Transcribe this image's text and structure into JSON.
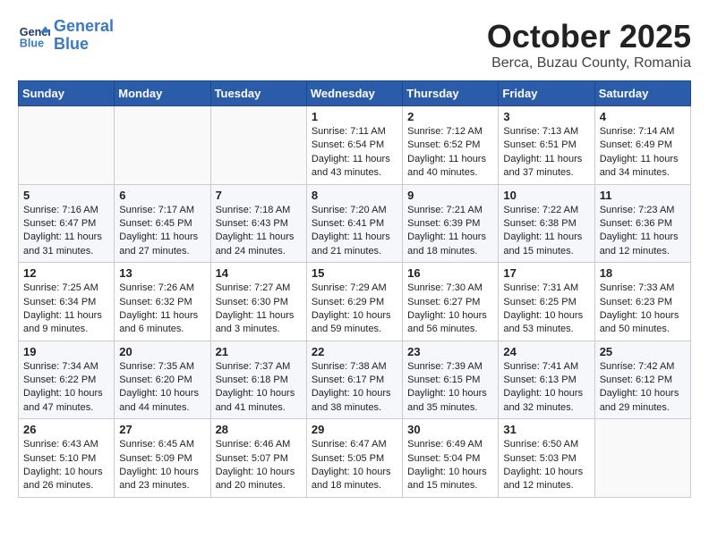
{
  "header": {
    "logo_line1": "General",
    "logo_line2": "Blue",
    "month": "October 2025",
    "location": "Berca, Buzau County, Romania"
  },
  "weekdays": [
    "Sunday",
    "Monday",
    "Tuesday",
    "Wednesday",
    "Thursday",
    "Friday",
    "Saturday"
  ],
  "weeks": [
    [
      {
        "day": "",
        "info": ""
      },
      {
        "day": "",
        "info": ""
      },
      {
        "day": "",
        "info": ""
      },
      {
        "day": "1",
        "info": "Sunrise: 7:11 AM\nSunset: 6:54 PM\nDaylight: 11 hours and 43 minutes."
      },
      {
        "day": "2",
        "info": "Sunrise: 7:12 AM\nSunset: 6:52 PM\nDaylight: 11 hours and 40 minutes."
      },
      {
        "day": "3",
        "info": "Sunrise: 7:13 AM\nSunset: 6:51 PM\nDaylight: 11 hours and 37 minutes."
      },
      {
        "day": "4",
        "info": "Sunrise: 7:14 AM\nSunset: 6:49 PM\nDaylight: 11 hours and 34 minutes."
      }
    ],
    [
      {
        "day": "5",
        "info": "Sunrise: 7:16 AM\nSunset: 6:47 PM\nDaylight: 11 hours and 31 minutes."
      },
      {
        "day": "6",
        "info": "Sunrise: 7:17 AM\nSunset: 6:45 PM\nDaylight: 11 hours and 27 minutes."
      },
      {
        "day": "7",
        "info": "Sunrise: 7:18 AM\nSunset: 6:43 PM\nDaylight: 11 hours and 24 minutes."
      },
      {
        "day": "8",
        "info": "Sunrise: 7:20 AM\nSunset: 6:41 PM\nDaylight: 11 hours and 21 minutes."
      },
      {
        "day": "9",
        "info": "Sunrise: 7:21 AM\nSunset: 6:39 PM\nDaylight: 11 hours and 18 minutes."
      },
      {
        "day": "10",
        "info": "Sunrise: 7:22 AM\nSunset: 6:38 PM\nDaylight: 11 hours and 15 minutes."
      },
      {
        "day": "11",
        "info": "Sunrise: 7:23 AM\nSunset: 6:36 PM\nDaylight: 11 hours and 12 minutes."
      }
    ],
    [
      {
        "day": "12",
        "info": "Sunrise: 7:25 AM\nSunset: 6:34 PM\nDaylight: 11 hours and 9 minutes."
      },
      {
        "day": "13",
        "info": "Sunrise: 7:26 AM\nSunset: 6:32 PM\nDaylight: 11 hours and 6 minutes."
      },
      {
        "day": "14",
        "info": "Sunrise: 7:27 AM\nSunset: 6:30 PM\nDaylight: 11 hours and 3 minutes."
      },
      {
        "day": "15",
        "info": "Sunrise: 7:29 AM\nSunset: 6:29 PM\nDaylight: 10 hours and 59 minutes."
      },
      {
        "day": "16",
        "info": "Sunrise: 7:30 AM\nSunset: 6:27 PM\nDaylight: 10 hours and 56 minutes."
      },
      {
        "day": "17",
        "info": "Sunrise: 7:31 AM\nSunset: 6:25 PM\nDaylight: 10 hours and 53 minutes."
      },
      {
        "day": "18",
        "info": "Sunrise: 7:33 AM\nSunset: 6:23 PM\nDaylight: 10 hours and 50 minutes."
      }
    ],
    [
      {
        "day": "19",
        "info": "Sunrise: 7:34 AM\nSunset: 6:22 PM\nDaylight: 10 hours and 47 minutes."
      },
      {
        "day": "20",
        "info": "Sunrise: 7:35 AM\nSunset: 6:20 PM\nDaylight: 10 hours and 44 minutes."
      },
      {
        "day": "21",
        "info": "Sunrise: 7:37 AM\nSunset: 6:18 PM\nDaylight: 10 hours and 41 minutes."
      },
      {
        "day": "22",
        "info": "Sunrise: 7:38 AM\nSunset: 6:17 PM\nDaylight: 10 hours and 38 minutes."
      },
      {
        "day": "23",
        "info": "Sunrise: 7:39 AM\nSunset: 6:15 PM\nDaylight: 10 hours and 35 minutes."
      },
      {
        "day": "24",
        "info": "Sunrise: 7:41 AM\nSunset: 6:13 PM\nDaylight: 10 hours and 32 minutes."
      },
      {
        "day": "25",
        "info": "Sunrise: 7:42 AM\nSunset: 6:12 PM\nDaylight: 10 hours and 29 minutes."
      }
    ],
    [
      {
        "day": "26",
        "info": "Sunrise: 6:43 AM\nSunset: 5:10 PM\nDaylight: 10 hours and 26 minutes."
      },
      {
        "day": "27",
        "info": "Sunrise: 6:45 AM\nSunset: 5:09 PM\nDaylight: 10 hours and 23 minutes."
      },
      {
        "day": "28",
        "info": "Sunrise: 6:46 AM\nSunset: 5:07 PM\nDaylight: 10 hours and 20 minutes."
      },
      {
        "day": "29",
        "info": "Sunrise: 6:47 AM\nSunset: 5:05 PM\nDaylight: 10 hours and 18 minutes."
      },
      {
        "day": "30",
        "info": "Sunrise: 6:49 AM\nSunset: 5:04 PM\nDaylight: 10 hours and 15 minutes."
      },
      {
        "day": "31",
        "info": "Sunrise: 6:50 AM\nSunset: 5:03 PM\nDaylight: 10 hours and 12 minutes."
      },
      {
        "day": "",
        "info": ""
      }
    ]
  ]
}
